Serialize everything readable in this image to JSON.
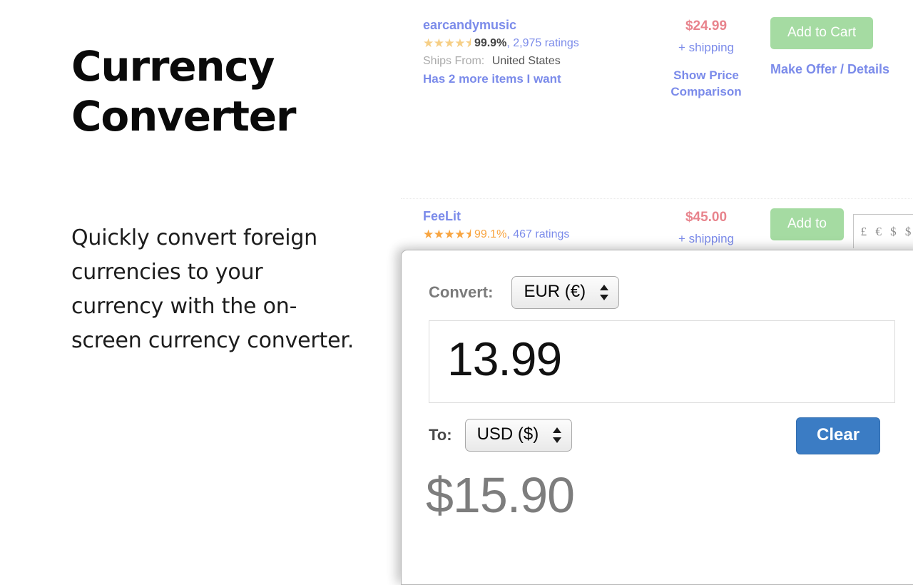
{
  "promo": {
    "title": "Currency\nConverter",
    "body": "Quickly convert foreign currencies to your currency with the on-screen currency converter."
  },
  "background": {
    "listings": [
      {
        "seller": "earcandymusic",
        "stars": "★★★★⯨",
        "rating_percent": "99.9%",
        "rating_separator": ",",
        "ratings_count": "2,975",
        "ratings_word": "ratings",
        "ships_from_label": "Ships From:",
        "ships_from_value": "United States",
        "more_items": "Has 2 more items I want",
        "price": "$24.99",
        "shipping": "+ shipping",
        "price_comparison": "Show Price Comparison",
        "add_to_cart": "Add to Cart",
        "make_offer": "Make Offer / Details"
      },
      {
        "seller": "FeeLit",
        "stars": "★★★★⯨",
        "rating_percent": "99.1%",
        "rating_separator": ",",
        "ratings_count": "467 ratings",
        "price": "$45.00",
        "shipping": "+ shipping",
        "add_to_cart": "Add to"
      }
    ],
    "currency_badge_glyphs": "£ € $ $"
  },
  "converter": {
    "convert_label": "Convert:",
    "from_currency": "EUR (€)",
    "amount": "13.99",
    "to_label": "To:",
    "to_currency": "USD ($)",
    "clear_label": "Clear",
    "result": "$15.90"
  },
  "colors": {
    "link_blue": "#7b8bea",
    "price_red": "#e8848d",
    "cart_green": "#a5dba2",
    "clear_blue": "#3b7cc4",
    "star_gold": "#f6cf86",
    "star_orange": "#f8a541",
    "result_gray": "#7d7d7d"
  }
}
